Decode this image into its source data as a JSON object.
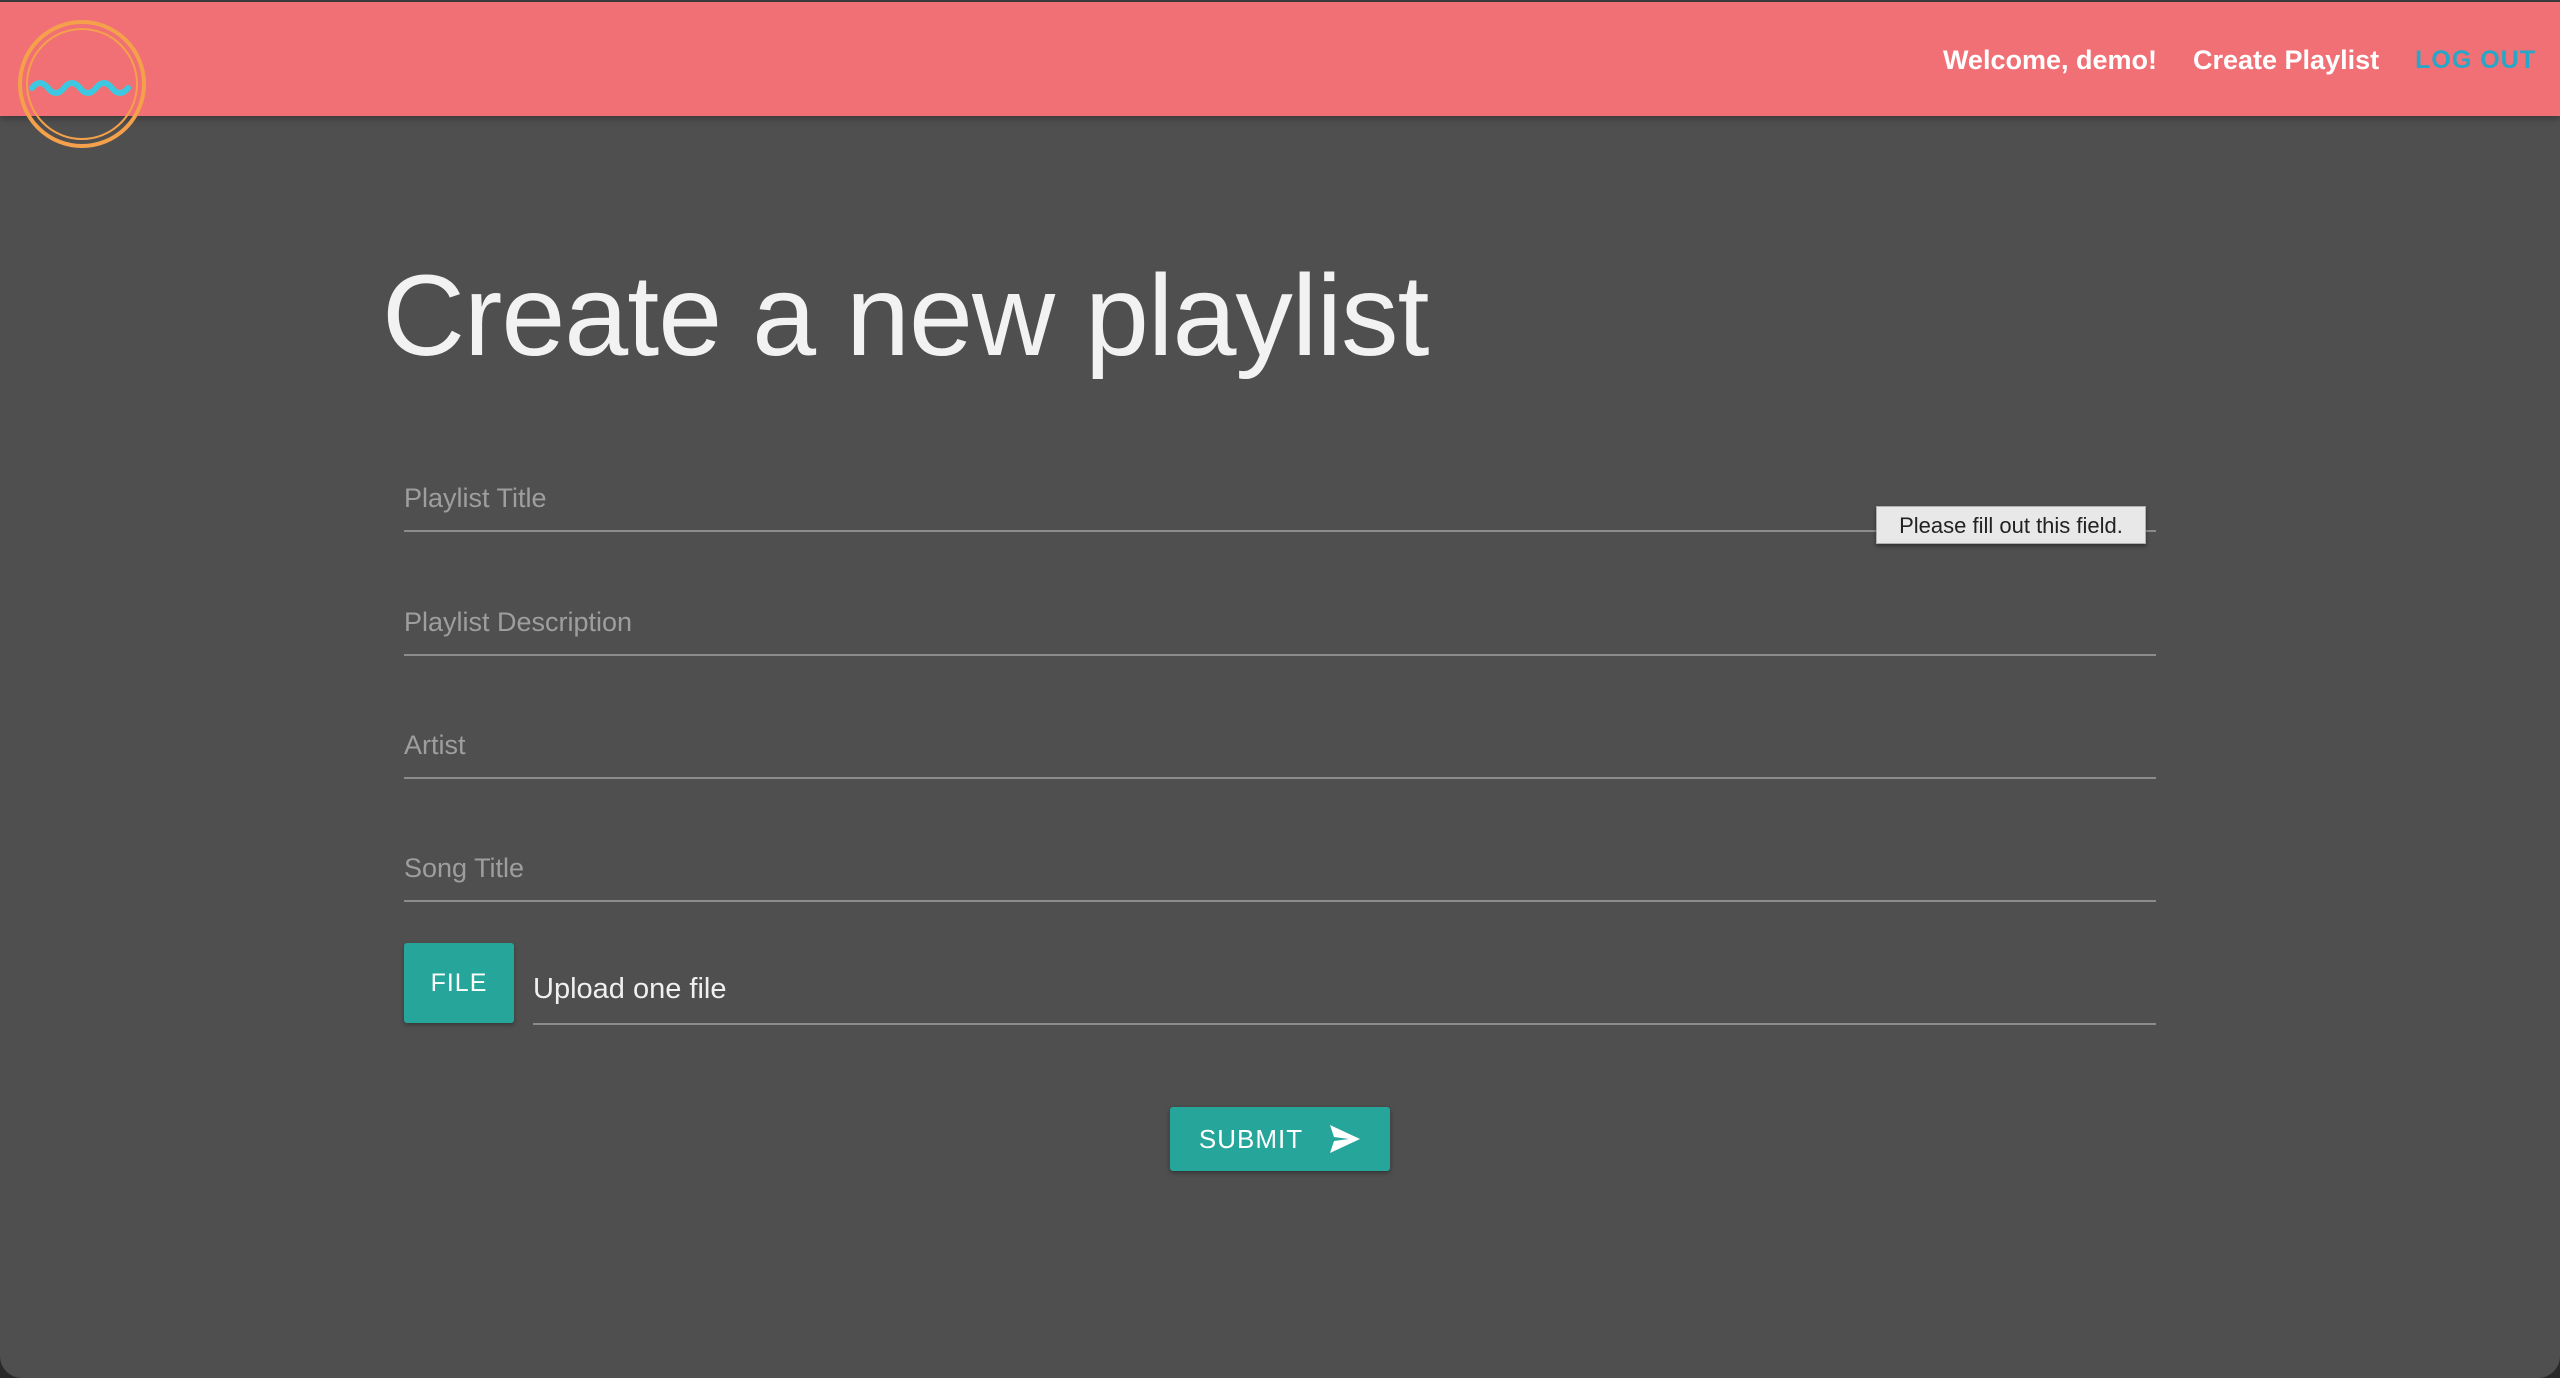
{
  "nav": {
    "logo_icon": "wave-circle-logo",
    "welcome": "Welcome, demo!",
    "create_playlist": "Create Playlist",
    "logout": "LOG OUT"
  },
  "main": {
    "title": "Create a new playlist",
    "fields": {
      "playlist_title": {
        "placeholder": "Playlist Title",
        "value": ""
      },
      "playlist_description": {
        "placeholder": "Playlist Description",
        "value": ""
      },
      "artist": {
        "placeholder": "Artist",
        "value": ""
      },
      "song_title": {
        "placeholder": "Song Title",
        "value": ""
      }
    },
    "validation_tooltip": "Please fill out this field.",
    "file": {
      "button_label": "FILE",
      "placeholder": "Upload one file"
    },
    "submit": {
      "label": "SUBMIT",
      "icon": "send-icon"
    }
  },
  "colors": {
    "navbar": "#f07075",
    "background": "#4f4f4f",
    "accent": "#26a69a",
    "logout": "#26a6c8",
    "logo_ring": "#f5a04a",
    "logo_wave": "#3ec8e0"
  }
}
